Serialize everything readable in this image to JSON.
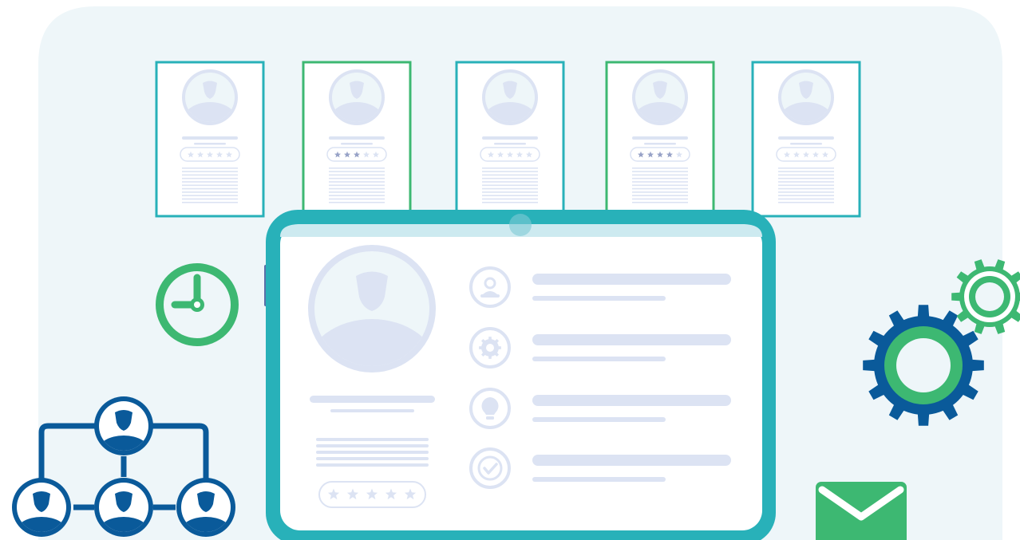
{
  "colors": {
    "background_panel": "#eef6f9",
    "teal_accent": "#28b1b9",
    "green_accent": "#3db872",
    "navy_accent": "#0a5a9a",
    "placeholder": "#dce3f3",
    "card_white": "#ffffff"
  },
  "profile_cards": [
    {
      "border": "teal",
      "rating": 0
    },
    {
      "border": "green",
      "rating": 3
    },
    {
      "border": "teal",
      "rating": 0
    },
    {
      "border": "green",
      "rating": 4
    },
    {
      "border": "teal",
      "rating": 0
    }
  ],
  "tablet": {
    "rating": 0,
    "detail_rows": [
      {
        "icon": "user-icon"
      },
      {
        "icon": "gear-icon"
      },
      {
        "icon": "lightbulb-icon"
      },
      {
        "icon": "check-circle-icon"
      }
    ]
  },
  "decorations": [
    "clock-icon",
    "org-chart-icon",
    "gears-icon",
    "envelope-icon"
  ]
}
